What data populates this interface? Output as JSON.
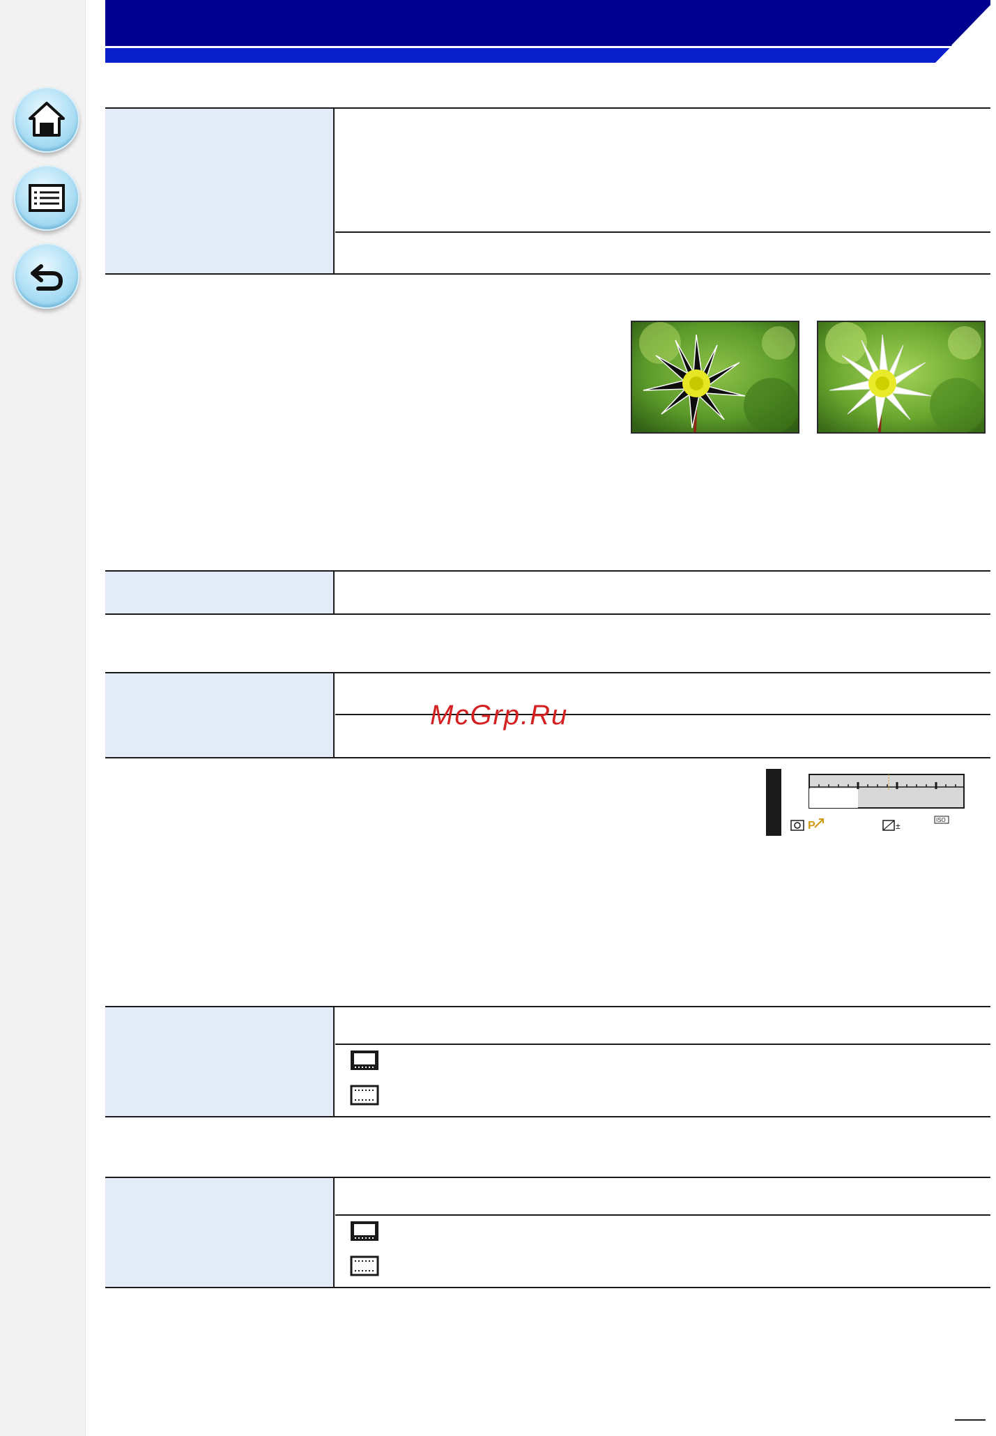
{
  "header": {
    "title": ""
  },
  "nav": {
    "home_label": "",
    "contents_label": "",
    "back_label": ""
  },
  "table1": {
    "label": "",
    "row1": "",
    "row2": ""
  },
  "table2": {
    "label": "",
    "row1": ""
  },
  "table3": {
    "label": "",
    "row1": "",
    "row2": ""
  },
  "table4": {
    "label": "",
    "row1": "",
    "row2": "",
    "row3": ""
  },
  "table5": {
    "label": "",
    "row1": "",
    "row2": "",
    "row3": ""
  },
  "camera_screen": {
    "iso_label": "ISO",
    "exposure_label": "±"
  },
  "watermark": "McGrp.Ru",
  "page_number": ""
}
